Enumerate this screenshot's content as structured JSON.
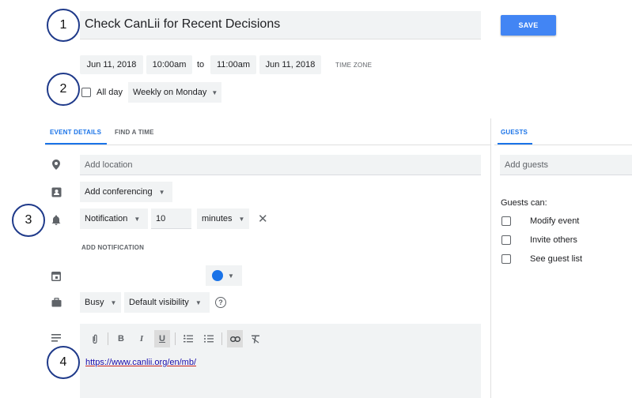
{
  "event": {
    "title": "Check CanLii for Recent Decisions",
    "save_label": "SAVE"
  },
  "datetime": {
    "start_date": "Jun 11, 2018",
    "start_time": "10:00am",
    "to_label": "to",
    "end_time": "11:00am",
    "end_date": "Jun 11, 2018",
    "time_zone_label": "TIME ZONE"
  },
  "recurrence": {
    "all_day_label": "All day",
    "repeat_value": "Weekly on Monday"
  },
  "tabs": {
    "event_details": "EVENT DETAILS",
    "find_a_time": "FIND A TIME",
    "guests": "GUESTS"
  },
  "details": {
    "location_placeholder": "Add location",
    "conferencing_label": "Add conferencing",
    "notification_type": "Notification",
    "notification_amount": "10",
    "notification_unit": "minutes",
    "add_notification_label": "ADD NOTIFICATION",
    "calendar_color": "#1a73e8",
    "availability": "Busy",
    "visibility": "Default visibility"
  },
  "description": {
    "url": "https://www.canlii.org/en/mb/"
  },
  "guests": {
    "add_guests_placeholder": "Add guests",
    "guests_can_label": "Guests can:",
    "permissions": [
      "Modify event",
      "Invite others",
      "See guest list"
    ]
  },
  "annotations": [
    "1",
    "2",
    "3",
    "4"
  ],
  "colors": {
    "accent": "#1a73e8",
    "save_button": "#4285f4",
    "annotation_border": "#1f3a8a"
  }
}
